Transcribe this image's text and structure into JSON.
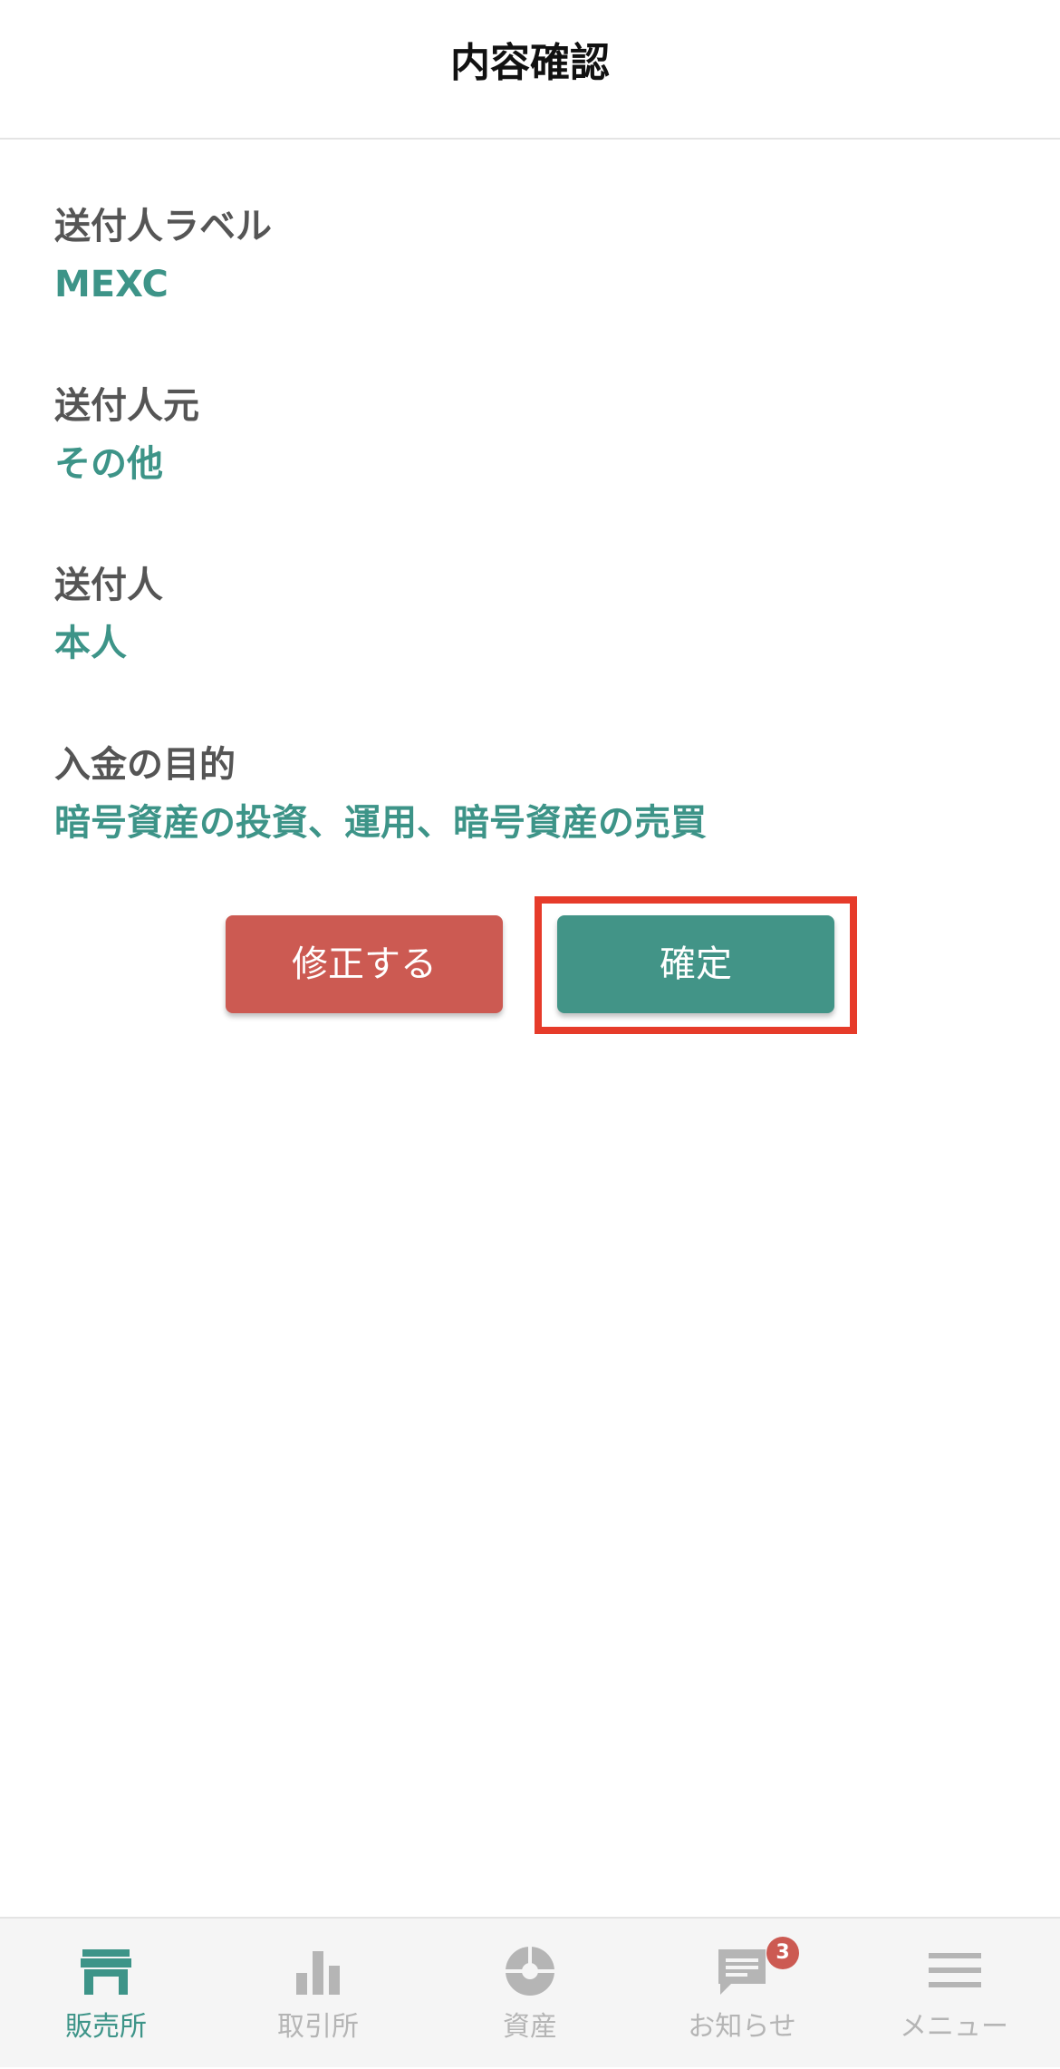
{
  "header": {
    "title": "内容確認"
  },
  "fields": [
    {
      "label": "送付人ラベル",
      "value": "MEXC"
    },
    {
      "label": "送付人元",
      "value": "その他"
    },
    {
      "label": "送付人",
      "value": "本人"
    },
    {
      "label": "入金の目的",
      "value": "暗号資産の投資、運用、暗号資産の売買"
    }
  ],
  "buttons": {
    "edit_label": "修正する",
    "confirm_label": "確定"
  },
  "colors": {
    "accent": "#3d9488",
    "confirm": "#429487",
    "edit": "#cc5a52",
    "highlight": "#e63b2a",
    "inactive": "#b5b5b5"
  },
  "tabs": [
    {
      "label": "販売所",
      "icon": "store-icon",
      "active": true
    },
    {
      "label": "取引所",
      "icon": "bar-chart-icon",
      "active": false
    },
    {
      "label": "資産",
      "icon": "pie-chart-icon",
      "active": false
    },
    {
      "label": "お知らせ",
      "icon": "message-icon",
      "active": false,
      "badge": "3"
    },
    {
      "label": "メニュー",
      "icon": "menu-icon",
      "active": false
    }
  ]
}
